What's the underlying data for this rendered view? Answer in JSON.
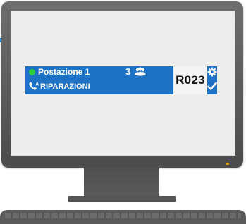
{
  "ticket": {
    "station_label": "Postazione 1",
    "queue_count": "3",
    "service_label": "RIPARAZIONI",
    "phone_badge": "A",
    "ticket_number": "R023"
  },
  "icons": {
    "status": "status-dot-icon",
    "people": "people-icon",
    "phone": "phone-call-icon",
    "settings": "gear-icon",
    "confirm": "check-icon"
  },
  "colors": {
    "panel_blue": "#1d72c6",
    "status_green": "#2ecc40",
    "ticket_box": "#f4f4f4",
    "screen_bg": "#ededed",
    "monitor_frame": "#5a5a5a"
  }
}
